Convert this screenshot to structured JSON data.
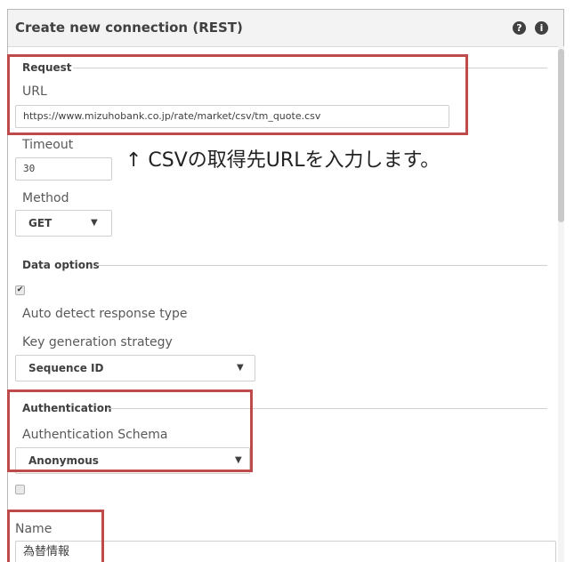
{
  "dialog": {
    "title": "Create new connection (REST)",
    "help_icon": "question-circle-icon",
    "info_icon": "info-circle-icon"
  },
  "request": {
    "section": "Request",
    "url_label": "URL",
    "url_value": "https://www.mizuhobank.co.jp/rate/market/csv/tm_quote.csv",
    "timeout_label": "Timeout",
    "timeout_value": "30",
    "method_label": "Method",
    "method_value": "GET"
  },
  "annotation": "↑ CSVの取得先URLを入力します。",
  "data_options": {
    "section": "Data options",
    "auto_detect_checked": true,
    "auto_detect_label": "Auto detect response type",
    "key_label": "Key generation strategy",
    "key_value": "Sequence ID"
  },
  "authentication": {
    "section": "Authentication",
    "schema_label": "Authentication Schema",
    "schema_value": "Anonymous",
    "checkbox_checked": false
  },
  "name": {
    "label": "Name",
    "value": "為替情報"
  },
  "colors": {
    "highlight": "#bf4a4a",
    "header_bg": "#f3f3f3",
    "text": "#404040"
  }
}
